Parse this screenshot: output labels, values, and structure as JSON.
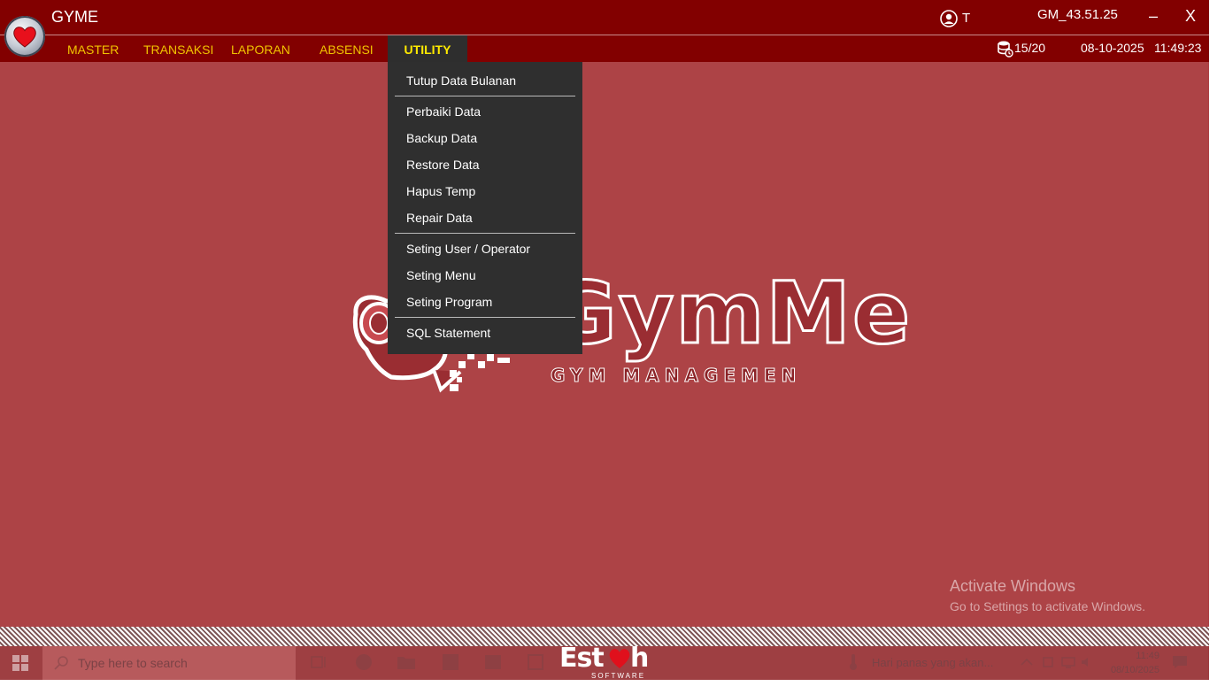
{
  "app": {
    "title": "GYME",
    "user": "T",
    "version": "GM_43.51.25",
    "minimize_label": "–",
    "close_label": "X"
  },
  "menu": {
    "items": [
      "MASTER",
      "TRANSAKSI",
      "LAPORAN",
      "ABSENSI",
      "UTILITY"
    ],
    "active": "UTILITY"
  },
  "status": {
    "connections": "15/20",
    "date": "08-10-2025",
    "time": "11:49:23"
  },
  "utility_menu": {
    "items": [
      "Tutup Data Bulanan",
      "Perbaiki Data",
      "Backup Data",
      "Restore Data",
      "Hapus Temp",
      "Repair Data",
      "Seting User / Operator",
      "Seting Menu",
      "Seting Program",
      "SQL Statement"
    ]
  },
  "logo": {
    "wordmark": "GymMe",
    "subtitle": "GYM MANAGEMEN"
  },
  "watermark": {
    "title": "Activate Windows",
    "subtitle": "Go to Settings to activate Windows."
  },
  "taskbar": {
    "search_placeholder": "Type here to search",
    "weather": "Hari panas yang akan...",
    "clock_time": "11:49",
    "clock_date": "08/10/2025",
    "brand_left": "Est",
    "brand_right": "h",
    "brand_sub": "SOFTWARE"
  },
  "colors": {
    "title_bar": "#820000",
    "menu_text": "#f2c400",
    "active_menu_text": "#ffea00",
    "workspace": "#ad4346",
    "dropdown_bg": "#2f2f2f"
  }
}
